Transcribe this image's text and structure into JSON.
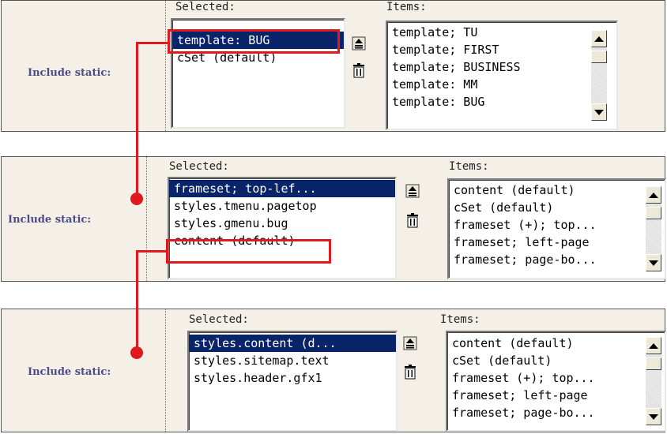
{
  "colors": {
    "highlight": "#e0191f",
    "selection": "#0a246a",
    "panel": "#f4f0e7",
    "label": "#4c4c87"
  },
  "panels": [
    {
      "label": "Include static:",
      "selected_header": "Selected:",
      "items_header": "Items:",
      "selected_list": [
        "template: BUG",
        "cSet (default)"
      ],
      "items_list": [
        "template; TU",
        "template; FIRST",
        "template; BUSINESS",
        "template: MM",
        "template: BUG"
      ],
      "icons": [
        "move-up-icon",
        "trash-icon"
      ]
    },
    {
      "label": "Include static:",
      "selected_header": "Selected:",
      "items_header": "Items:",
      "selected_list": [
        "frameset; top-lef...",
        "styles.tmenu.pagetop",
        "styles.gmenu.bug",
        "content (default)"
      ],
      "items_list": [
        "content (default)",
        "cSet (default)",
        "frameset (+); top...",
        "frameset; left-page",
        "frameset; page-bo..."
      ],
      "icons": [
        "move-up-icon",
        "trash-icon"
      ]
    },
    {
      "label": "Include static:",
      "selected_header": "Selected:",
      "items_header": "Items:",
      "selected_list": [
        "styles.content (d...",
        "styles.sitemap.text",
        "styles.header.gfx1"
      ],
      "items_list": [
        "content (default)",
        "cSet (default)",
        "frameset (+); top...",
        "frameset; left-page",
        "frameset; page-bo..."
      ],
      "icons": [
        "move-up-icon",
        "trash-icon"
      ]
    }
  ]
}
